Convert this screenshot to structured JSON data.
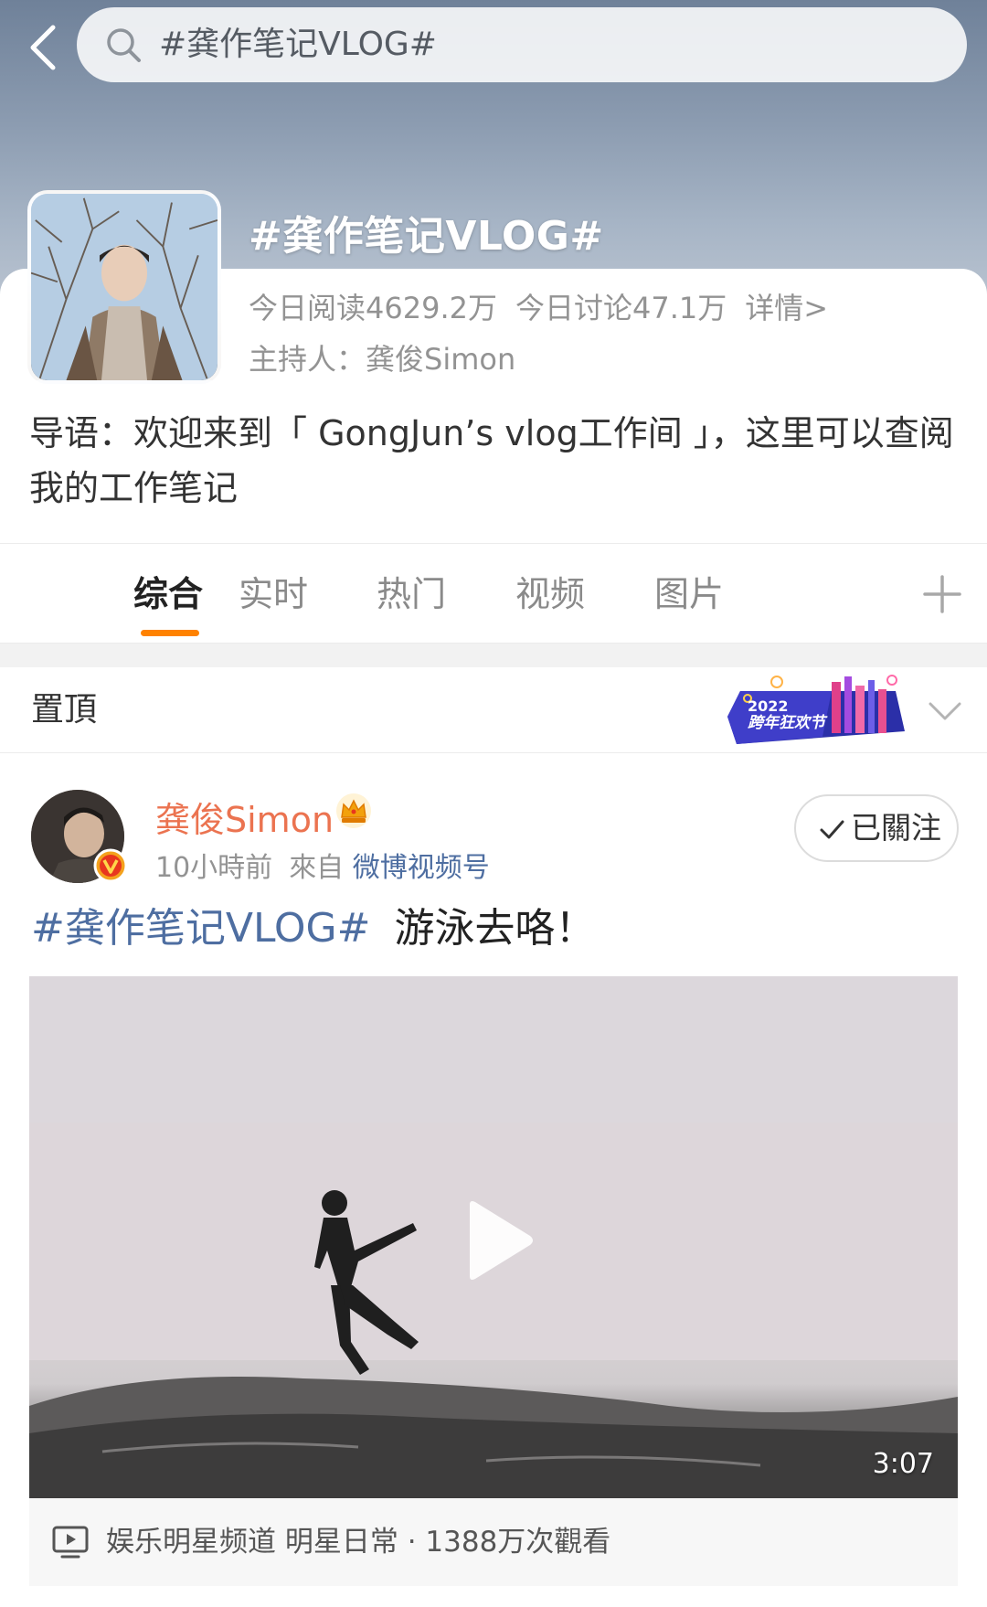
{
  "search": {
    "query": "#龚作笔记VLOG#"
  },
  "topic": {
    "title": "#龚作笔记VLOG#",
    "reads_today": "今日阅读4629.2万",
    "discussions_today": "今日讨论47.1万",
    "details_link": "详情>",
    "host": "主持人：龚俊Simon",
    "intro": "导语：欢迎来到「 GongJun’s vlog工作间 」，这里可以查阅我的工作笔记"
  },
  "tabs": [
    {
      "label": "综合",
      "active": true
    },
    {
      "label": "实时",
      "active": false
    },
    {
      "label": "热门",
      "active": false
    },
    {
      "label": "视频",
      "active": false
    },
    {
      "label": "图片",
      "active": false
    }
  ],
  "pinned": {
    "label": "置頂",
    "badge_year": "2022",
    "badge_name": "跨年狂欢节"
  },
  "post": {
    "author": "龚俊Simon",
    "time": "10小時前",
    "from_label": "來自",
    "source": "微博视频号",
    "follow_label": "已關注",
    "hashtag": "#龚作笔记VLOG#",
    "text": "游泳去咯！",
    "video": {
      "duration": "3:07",
      "footer": "娱乐明星频道 明星日常 · 1388万次觀看"
    }
  },
  "colors": {
    "accent_orange": "#ff8200",
    "author_orange": "#eb7350",
    "link_blue": "#4e6ea1",
    "muted_gray": "#939393"
  }
}
